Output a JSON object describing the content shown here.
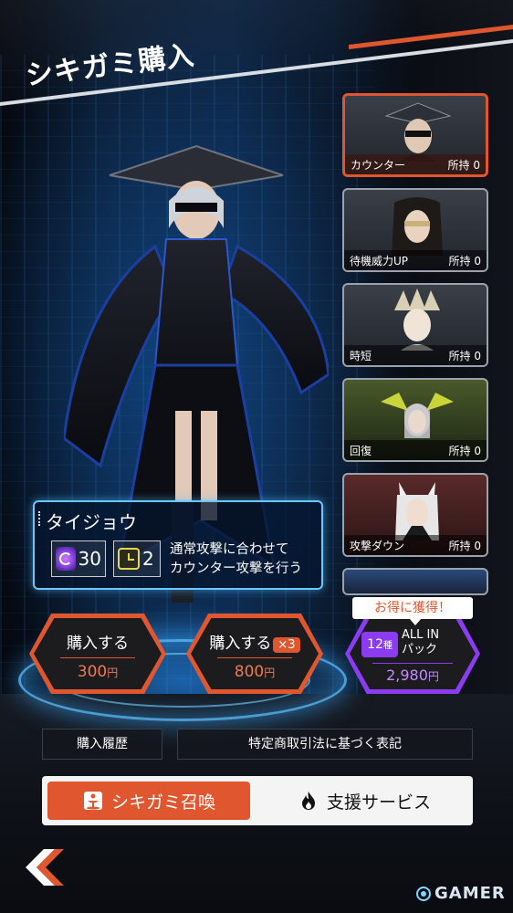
{
  "header": {
    "title": "シキガミ購入"
  },
  "shikigami_list": [
    {
      "skill": "カウンター",
      "owned": "所持 0",
      "selected": true
    },
    {
      "skill": "待機威力UP",
      "owned": "所持 0",
      "selected": false
    },
    {
      "skill": "時短",
      "owned": "所持 0",
      "selected": false
    },
    {
      "skill": "回復",
      "owned": "所持 0",
      "selected": false
    },
    {
      "skill": "攻撃ダウン",
      "owned": "所持 0",
      "selected": false
    }
  ],
  "info": {
    "name": "タイジョウ",
    "cost": "30",
    "cooldown": "2",
    "description_line1": "通常攻撃に合わせて",
    "description_line2": "カウンター攻撃を行う"
  },
  "buy_single": {
    "label": "購入する",
    "price": "300",
    "unit": "円"
  },
  "buy_triple": {
    "label": "購入する",
    "badge": "×3",
    "price": "800",
    "unit": "円"
  },
  "pack": {
    "tag": "お得に獲得！",
    "count": "12",
    "count_unit": "種",
    "name_line1": "ALL IN",
    "name_line2": "パック",
    "price": "2,980",
    "unit": "円"
  },
  "links": {
    "history": "購入履歴",
    "legal": "特定商取引法に基づく表記"
  },
  "tabs": {
    "summon": "シキガミ召喚",
    "support": "支援サービス"
  },
  "watermark": "GAMER",
  "colors": {
    "accent": "#e0562e",
    "pack": "#8b3cf0",
    "info_border": "#6cc6ff"
  }
}
